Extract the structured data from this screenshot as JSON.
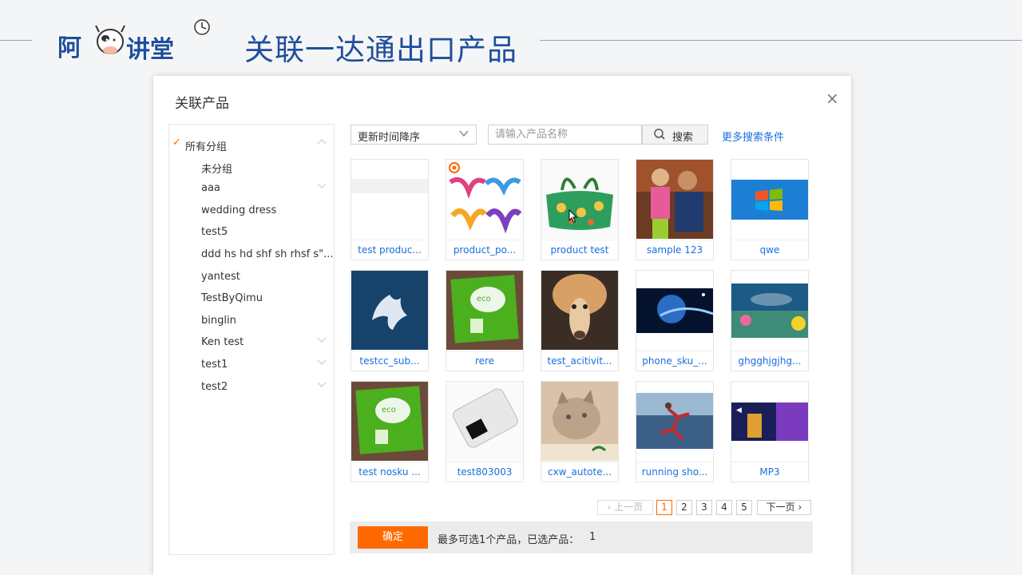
{
  "slide": {
    "logo_text": "阿讲堂",
    "title": "关联一达通出口产品"
  },
  "dialog": {
    "title": "关联产品",
    "close_symbol": "×",
    "groups": [
      {
        "label": "所有分组",
        "checked": true,
        "chevron": "up"
      },
      {
        "label": "未分组"
      },
      {
        "label": "aaa",
        "chevron": "down"
      },
      {
        "label": "wedding dress"
      },
      {
        "label": "test5"
      },
      {
        "label": "ddd hs hd shf sh rhsf s\"..."
      },
      {
        "label": "yantest"
      },
      {
        "label": "TestByQimu"
      },
      {
        "label": "binglin"
      },
      {
        "label": "Ken test",
        "chevron": "down"
      },
      {
        "label": "test1",
        "chevron": "down"
      },
      {
        "label": "test2",
        "chevron": "down"
      }
    ],
    "sort": {
      "value": "更新时间降序"
    },
    "search": {
      "placeholder": "请输入产品名称",
      "button_label": "搜索",
      "more_link": "更多搜索条件"
    },
    "products": [
      {
        "name": "test produc...",
        "thumb": "blank"
      },
      {
        "name": "product_po...",
        "thumb": "figures"
      },
      {
        "name": "product test",
        "thumb": "bag"
      },
      {
        "name": "sample 123",
        "thumb": "people"
      },
      {
        "name": "qwe",
        "thumb": "windows"
      },
      {
        "name": "testcc_sub...",
        "thumb": "bird"
      },
      {
        "name": "rere",
        "thumb": "eco"
      },
      {
        "name": "test_acitivit...",
        "thumb": "alpaca"
      },
      {
        "name": "phone_sku_...",
        "thumb": "earth"
      },
      {
        "name": "ghgghjgjhg...",
        "thumb": "flowers"
      },
      {
        "name": "test nosku ...",
        "thumb": "eco"
      },
      {
        "name": "test803003",
        "thumb": "device"
      },
      {
        "name": "cxw_autote...",
        "thumb": "cat"
      },
      {
        "name": "running sho...",
        "thumb": "runner"
      },
      {
        "name": "MP3",
        "thumb": "dark"
      }
    ],
    "pagination": {
      "prev": "上一页",
      "pages": [
        "1",
        "2",
        "3",
        "4",
        "5"
      ],
      "current": "1",
      "next": "下一页"
    },
    "footer": {
      "confirm": "确定",
      "note": "最多可选1个产品，已选产品：",
      "selected_count": "1"
    },
    "colors": {
      "accent": "#ff6a00",
      "link": "#1a6fdc",
      "title": "#1f4e9c"
    }
  }
}
